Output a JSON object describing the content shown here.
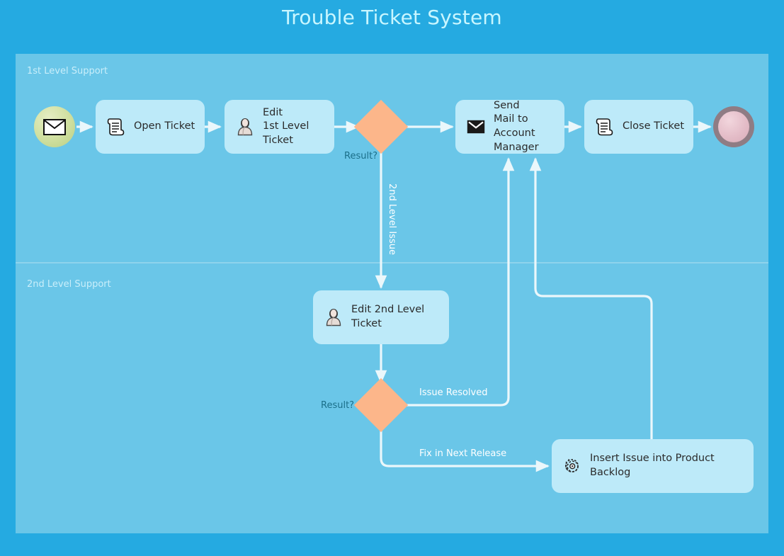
{
  "title": "Trouble Ticket System",
  "colors": {
    "canvas_background": "#25aae1",
    "pool_background": "#6ac6e8",
    "task_fill": "#bdeaf9",
    "gateway_fill": "#fcb68a",
    "connector": "#eaf7fb",
    "title_text": "#c8f6ff",
    "lane_label_text": "#c9eefa",
    "gateway_label_text": "#1b6f89",
    "flow_label_text": "#ffffff",
    "start_event_fill": "#cfdf9e",
    "end_event_fill": "#e4bdc8",
    "end_event_ring": "#8f7c84"
  },
  "lanes": [
    {
      "id": "lane1",
      "label": "1st Level Support"
    },
    {
      "id": "lane2",
      "label": "2nd Level Support"
    }
  ],
  "events": [
    {
      "id": "start",
      "type": "message-start-event",
      "icon": "envelope-icon",
      "label": ""
    },
    {
      "id": "end",
      "type": "end-event",
      "icon": "end-event-icon",
      "label": ""
    }
  ],
  "tasks": [
    {
      "id": "open-ticket",
      "label": "Open Ticket",
      "icon": "scroll-document-icon"
    },
    {
      "id": "edit-1st-level-ticket",
      "label": "Edit\n1st Level Ticket",
      "icon": "user-icon"
    },
    {
      "id": "send-mail-to-account-manager",
      "label": "Send\nMail to Account\nManager",
      "icon": "envelope-icon"
    },
    {
      "id": "close-ticket",
      "label": "Close Ticket",
      "icon": "scroll-document-icon"
    },
    {
      "id": "edit-2nd-level-ticket",
      "label": "Edit 2nd Level Ticket",
      "icon": "user-icon"
    },
    {
      "id": "insert-issue-into-product-backlog",
      "label": "Insert Issue into Product Backlog",
      "icon": "gear-icon"
    }
  ],
  "gateways": [
    {
      "id": "gateway-1",
      "label": "Result?"
    },
    {
      "id": "gateway-2",
      "label": "Result?"
    }
  ],
  "flow_labels": [
    {
      "id": "flow-2nd-level-issue",
      "label": "2nd Level Issue",
      "orientation": "vertical"
    },
    {
      "id": "flow-issue-resolved",
      "label": "Issue Resolved",
      "orientation": "horizontal"
    },
    {
      "id": "flow-fix-in-next-release",
      "label": "Fix in Next Release",
      "orientation": "horizontal"
    }
  ]
}
